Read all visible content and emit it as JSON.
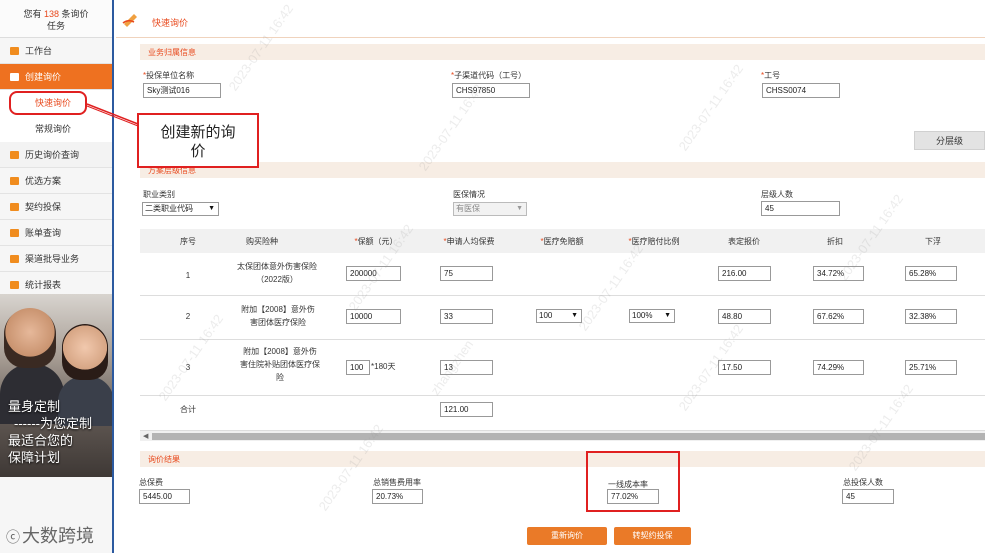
{
  "sidebar": {
    "task_prefix": "您有",
    "task_count": "138",
    "task_suffix": "条询价",
    "task_line2": "任务",
    "items": [
      {
        "label": "工作台"
      },
      {
        "label": "创建询价"
      },
      {
        "label": "快速询价"
      },
      {
        "label": "常规询价"
      },
      {
        "label": "历史询价查询"
      },
      {
        "label": "优选方案"
      },
      {
        "label": "契约投保"
      },
      {
        "label": "账单查询"
      },
      {
        "label": "渠道批导业务"
      },
      {
        "label": "统计报表"
      }
    ],
    "banner_lines": [
      "量身定制",
      "------为您定制",
      "最适合您的",
      "保障计划"
    ],
    "bottom_logo": "大数跨境"
  },
  "page": {
    "title": "快速询价",
    "section_business": "业务归属信息",
    "section_plan": "方案层级信息",
    "section_result": "询价结果"
  },
  "business": {
    "unit_label": "投保单位名称",
    "unit_value": "Sky测试016",
    "channel_label": "子渠道代码（工号）",
    "channel_value": "CHS97850",
    "job_label": "工号",
    "job_value": "CHSS0074"
  },
  "tier_button": "分层级",
  "plan": {
    "occupation_label": "职业类别",
    "occupation_value": "二类职业代码",
    "medical_label": "医保情况",
    "medical_value": "有医保",
    "count_label": "层级人数",
    "count_value": "45"
  },
  "table": {
    "headers": [
      "序号",
      "购买险种",
      "保额（元）",
      "申请人均保费",
      "医疗免赔额",
      "医疗赔付比例",
      "表定报价",
      "折扣",
      "下浮"
    ],
    "required_headers": [
      "保额（元）",
      "申请人均保费",
      "医疗免赔额",
      "医疗赔付比例"
    ],
    "rows": [
      {
        "no": "1",
        "product": "太保团体意外伤害保险（2022版）",
        "amount": "200000",
        "premium": "75",
        "deductible": "",
        "ratio": "",
        "list_price": "216.00",
        "discount": "34.72%",
        "float": "65.28%"
      },
      {
        "no": "2",
        "product": "附加【2008】意外伤害团体医疗保险",
        "amount": "10000",
        "premium": "33",
        "deductible": "100",
        "ratio": "100%",
        "list_price": "48.80",
        "discount": "67.62%",
        "float": "32.38%"
      },
      {
        "no": "3",
        "product": "附加【2008】意外伤害住院补贴团体医疗保险",
        "amount": "100",
        "amount_suffix": "*180天",
        "premium": "13",
        "deductible": "",
        "ratio": "",
        "list_price": "17.50",
        "discount": "74.29%",
        "float": "25.71%"
      }
    ],
    "total_label": "合计",
    "total_value": "121.00"
  },
  "result": {
    "total_premium_label": "总保费",
    "total_premium_value": "5445.00",
    "sales_rate_label": "总销售费用率",
    "sales_rate_value": "20.73%",
    "cost_rate_label": "一线成本率",
    "cost_rate_value": "77.02%",
    "insured_label": "总投保人数",
    "insured_value": "45"
  },
  "buttons": {
    "requery": "重新询价",
    "convert": "转契约投保"
  },
  "callout": {
    "line1": "创建新的询",
    "line2": "价"
  },
  "watermark": [
    "2023-07-11 16:42",
    "zhangzhen"
  ],
  "colors": {
    "accent": "#e8491d",
    "active_nav": "#ee7120",
    "sidebar_border": "#2c5aa0",
    "annotation_red": "#e02020"
  }
}
